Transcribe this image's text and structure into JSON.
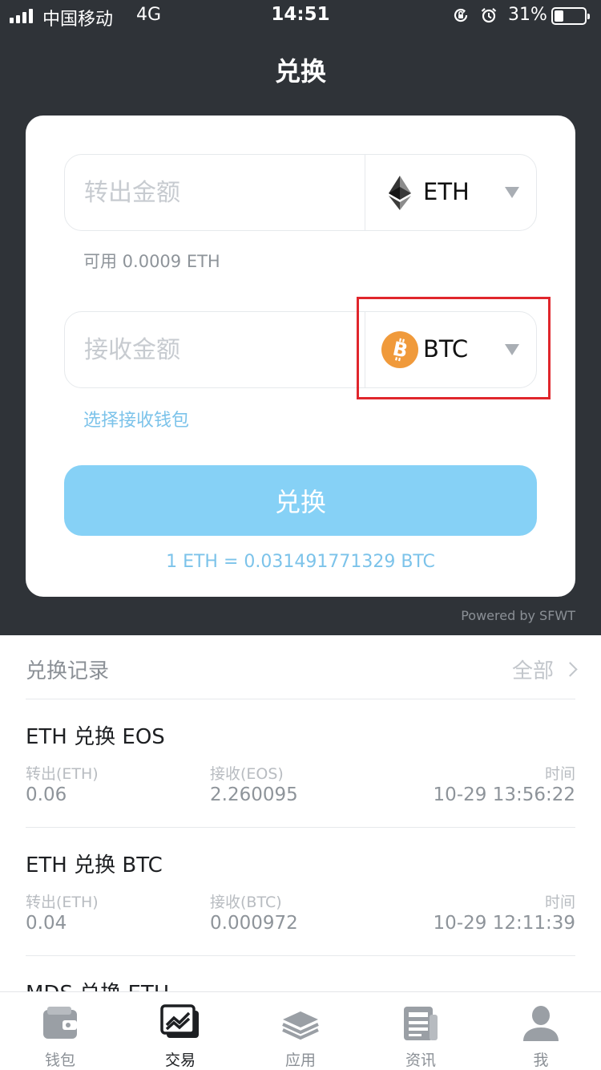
{
  "status_bar": {
    "carrier": "中国移动",
    "network": "4G",
    "time": "14:51",
    "battery_percent_text": "31%",
    "battery_level": 0.31,
    "icons": [
      "signal-icon",
      "orientation-lock-icon",
      "alarm-icon",
      "battery-icon"
    ]
  },
  "header": {
    "title": "兑换"
  },
  "exchange": {
    "send": {
      "placeholder": "转出金额",
      "coin": "ETH",
      "coin_icon": "ethereum-icon"
    },
    "available_text": "可用 0.0009 ETH",
    "receive": {
      "placeholder": "接收金额",
      "coin": "BTC",
      "coin_icon": "bitcoin-icon"
    },
    "choose_wallet": "选择接收钱包",
    "button_label": "兑换",
    "rate_text": "1 ETH = 0.031491771329 BTC",
    "powered_by": "Powered by SFWT"
  },
  "records": {
    "title": "兑换记录",
    "all_label": "全部",
    "items": [
      {
        "title": "ETH 兑换 EOS",
        "out_label": "转出(ETH)",
        "out_value": "0.06",
        "in_label": "接收(EOS)",
        "in_value": "2.260095",
        "time_label": "时间",
        "time_value": "10-29 13:56:22"
      },
      {
        "title": "ETH 兑换 BTC",
        "out_label": "转出(ETH)",
        "out_value": "0.04",
        "in_label": "接收(BTC)",
        "in_value": "0.000972",
        "time_label": "时间",
        "time_value": "10-29 12:11:39"
      },
      {
        "title": "MDS 兑换 ETH"
      }
    ]
  },
  "tab_bar": {
    "items": [
      {
        "label": "钱包",
        "icon": "wallet-icon"
      },
      {
        "label": "交易",
        "icon": "trade-chart-icon",
        "active": true
      },
      {
        "label": "应用",
        "icon": "layers-icon"
      },
      {
        "label": "资讯",
        "icon": "news-icon"
      },
      {
        "label": "我",
        "icon": "profile-icon"
      }
    ]
  },
  "colors": {
    "header_bg": "#2f3338",
    "accent": "#86d1f6",
    "link": "#7cc3ea",
    "highlight": "#e0262c",
    "bitcoin": "#f09a3b"
  }
}
